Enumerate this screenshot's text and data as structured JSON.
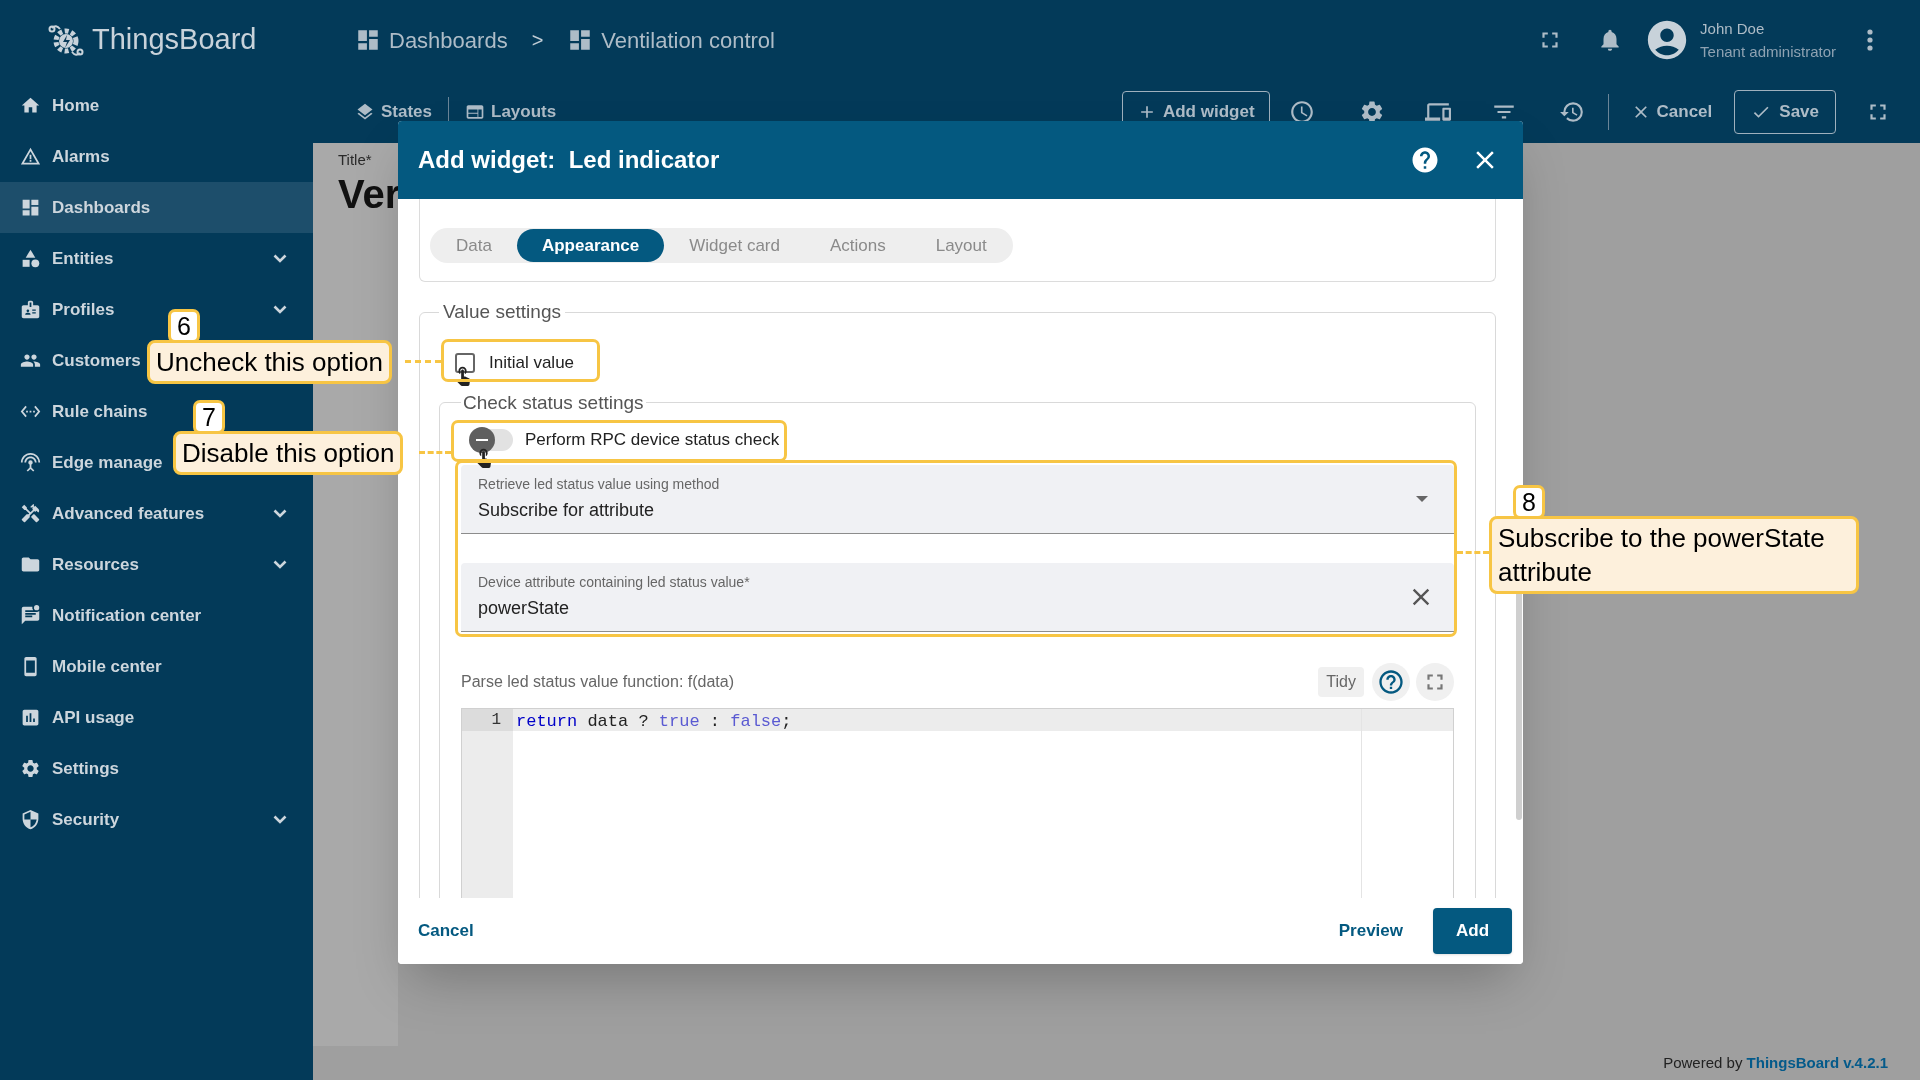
{
  "app": {
    "name": "ThingsBoard"
  },
  "breadcrumbs": [
    {
      "label": "Dashboards"
    },
    {
      "label": "Ventilation control"
    }
  ],
  "breadcrumb_separator": ">",
  "user": {
    "name": "John Doe",
    "role": "Tenant administrator"
  },
  "sidebar": {
    "items": [
      {
        "label": "Home",
        "selected": false,
        "has_submenu": false
      },
      {
        "label": "Alarms",
        "selected": false,
        "has_submenu": false
      },
      {
        "label": "Dashboards",
        "selected": true,
        "has_submenu": false
      },
      {
        "label": "Entities",
        "selected": false,
        "has_submenu": true
      },
      {
        "label": "Profiles",
        "selected": false,
        "has_submenu": true
      },
      {
        "label": "Customers",
        "selected": false,
        "has_submenu": false
      },
      {
        "label": "Rule chains",
        "selected": false,
        "has_submenu": false
      },
      {
        "label": "Edge manage",
        "selected": false,
        "has_submenu": false
      },
      {
        "label": "Advanced features",
        "selected": false,
        "has_submenu": true
      },
      {
        "label": "Resources",
        "selected": false,
        "has_submenu": true
      },
      {
        "label": "Notification center",
        "selected": false,
        "has_submenu": false
      },
      {
        "label": "Mobile center",
        "selected": false,
        "has_submenu": false
      },
      {
        "label": "API usage",
        "selected": false,
        "has_submenu": false
      },
      {
        "label": "Settings",
        "selected": false,
        "has_submenu": false
      },
      {
        "label": "Security",
        "selected": false,
        "has_submenu": true
      }
    ]
  },
  "toolbar": {
    "left": [
      {
        "label": "States"
      },
      {
        "label": "Layouts"
      }
    ],
    "add_widget": "Add widget",
    "cancel": "Cancel",
    "save": "Save"
  },
  "dashboard": {
    "title_label": "Title*",
    "title_value": "Ver"
  },
  "dialog": {
    "title_prefix": "Add widget:",
    "title": "Led indicator",
    "tabs": [
      {
        "label": "Data",
        "selected": false
      },
      {
        "label": "Appearance",
        "selected": true
      },
      {
        "label": "Widget card",
        "selected": false
      },
      {
        "label": "Actions",
        "selected": false
      },
      {
        "label": "Layout",
        "selected": false
      }
    ],
    "value_settings": {
      "legend": "Value settings",
      "initial_value": {
        "label": "Initial value",
        "checked": false
      },
      "check_status": {
        "legend": "Check status settings",
        "rpc_check": {
          "label": "Perform RPC device status check",
          "on": false
        },
        "retrieve_method": {
          "label": "Retrieve led status value using method",
          "value": "Subscribe for attribute"
        },
        "attribute": {
          "label": "Device attribute containing led status value*",
          "value": "powerState"
        },
        "parse_function": {
          "label": "Parse led status value function: f(data)",
          "tidy": "Tidy",
          "lines": [
            {
              "number": "1",
              "tokens": [
                {
                  "kind": "keyword",
                  "text": "return"
                },
                {
                  "kind": "plain",
                  "text": " data ? "
                },
                {
                  "kind": "constant",
                  "text": "true"
                },
                {
                  "kind": "plain",
                  "text": " : "
                },
                {
                  "kind": "constant",
                  "text": "false"
                },
                {
                  "kind": "plain",
                  "text": ";"
                }
              ]
            }
          ]
        }
      }
    },
    "buttons": {
      "cancel": "Cancel",
      "preview": "Preview",
      "add": "Add"
    }
  },
  "callouts": [
    {
      "number": "6",
      "text": "Uncheck this option"
    },
    {
      "number": "7",
      "text": "Disable this option"
    },
    {
      "number": "8",
      "text": "Subscribe to the powerState attribute"
    }
  ],
  "footer": {
    "prefix": "Powered by",
    "link": "ThingsBoard v.4.2.1"
  }
}
